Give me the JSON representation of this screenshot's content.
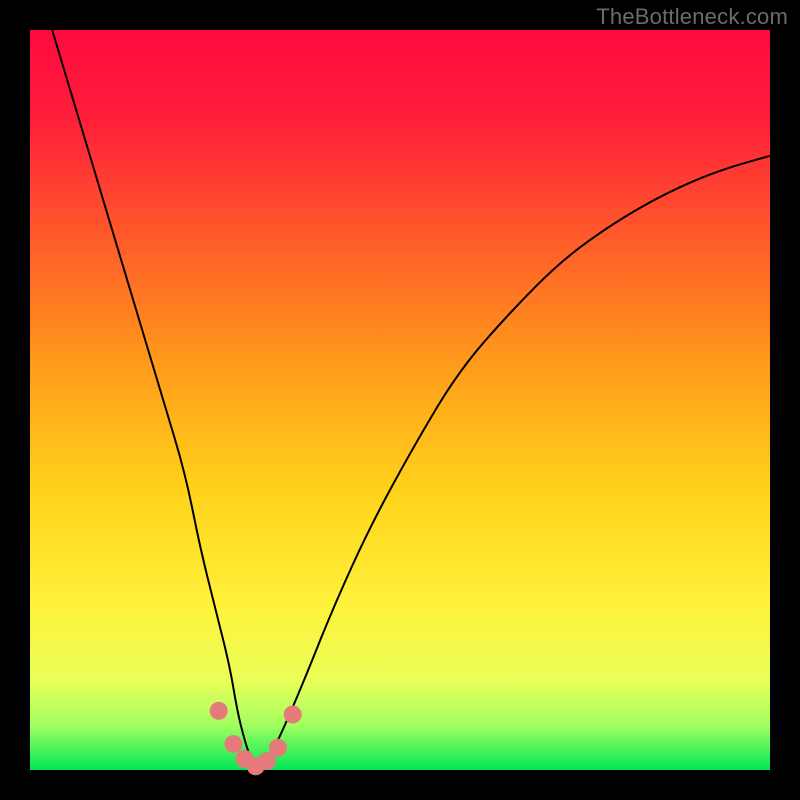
{
  "watermark": "TheBottleneck.com",
  "colors": {
    "frame": "#000000",
    "gradient_stops": [
      {
        "offset": 0.0,
        "color": "#ff0a3e"
      },
      {
        "offset": 0.12,
        "color": "#ff1f3a"
      },
      {
        "offset": 0.28,
        "color": "#ff5a2a"
      },
      {
        "offset": 0.45,
        "color": "#ff9a1a"
      },
      {
        "offset": 0.62,
        "color": "#ffd21a"
      },
      {
        "offset": 0.78,
        "color": "#fff23a"
      },
      {
        "offset": 0.88,
        "color": "#e8ff5a"
      },
      {
        "offset": 0.94,
        "color": "#a0ff60"
      },
      {
        "offset": 1.0,
        "color": "#00e856"
      }
    ],
    "curve": "#000000",
    "markers": "#e67a7a"
  },
  "chart_data": {
    "type": "line",
    "title": "",
    "xlabel": "",
    "ylabel": "",
    "xlim": [
      0,
      100
    ],
    "ylim": [
      0,
      100
    ],
    "annotations": [],
    "series": [
      {
        "name": "bottleneck-curve",
        "x": [
          3,
          6,
          9,
          12,
          15,
          18,
          21,
          23,
          25,
          27,
          28,
          29,
          30,
          31,
          32,
          34,
          37,
          41,
          46,
          52,
          58,
          65,
          72,
          79,
          86,
          93,
          100
        ],
        "y": [
          100,
          90,
          80,
          70,
          60,
          50,
          40,
          30,
          22,
          14,
          8,
          4,
          1,
          0,
          1,
          5,
          12,
          22,
          33,
          44,
          54,
          62,
          69,
          74,
          78,
          81,
          83
        ]
      }
    ],
    "markers": {
      "name": "highlight-points",
      "x": [
        25.5,
        27.5,
        29.0,
        30.5,
        32.0,
        33.5,
        35.5
      ],
      "y": [
        8.0,
        3.5,
        1.5,
        0.5,
        1.2,
        3.0,
        7.5
      ]
    }
  }
}
